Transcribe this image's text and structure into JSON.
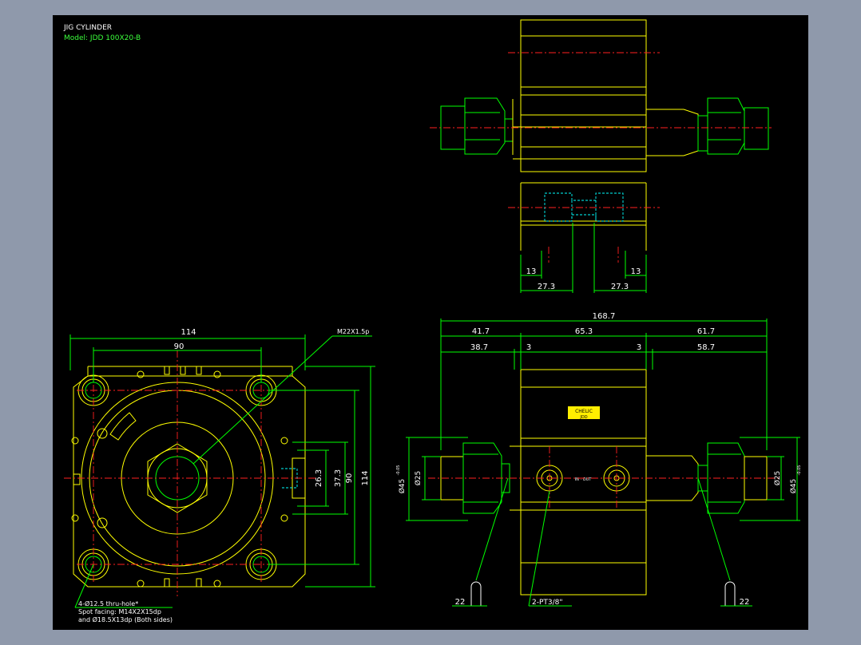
{
  "header": {
    "title": "JIG CYLINDER",
    "model": "Model: JDD 100X20-B"
  },
  "colors": {
    "outline": "#ffff00",
    "dim": "#00ff00",
    "center": "#ff2020",
    "hidden": "#00ffff",
    "text": "#ffffff",
    "background": "#000000",
    "frame": "#8f99ab"
  },
  "top_view": {
    "dims": [
      "13",
      "13",
      "27.3",
      "27.3"
    ]
  },
  "front_view": {
    "dims": {
      "d114": "114",
      "d90": "90",
      "d26_3": "26.3",
      "d37_3": "37.3",
      "d90v": "90",
      "d114v": "114"
    },
    "callout_port": "M22X1.5p",
    "callout_holes": [
      "4-Ø12.5 thru-hole*",
      "Spot facing: M14X2X15dp",
      "and Ø18.5X13dp (Both sides)"
    ]
  },
  "side_view": {
    "dims": {
      "total": "168.7",
      "left": "41.7",
      "mid": "65.3",
      "right": "61.7",
      "left2": "38.7",
      "gapL": "3",
      "gapR": "3",
      "right2": "58.7",
      "phi25L": "Ø25",
      "phi45L": "Ø45",
      "phi25R": "Ø25",
      "phi45R": "Ø45",
      "tol": "-0.05",
      "d22L": "22",
      "d22R": "22"
    },
    "port_label": "2-PT3/8\"",
    "badge": [
      "CHELIC",
      "JDD"
    ]
  }
}
